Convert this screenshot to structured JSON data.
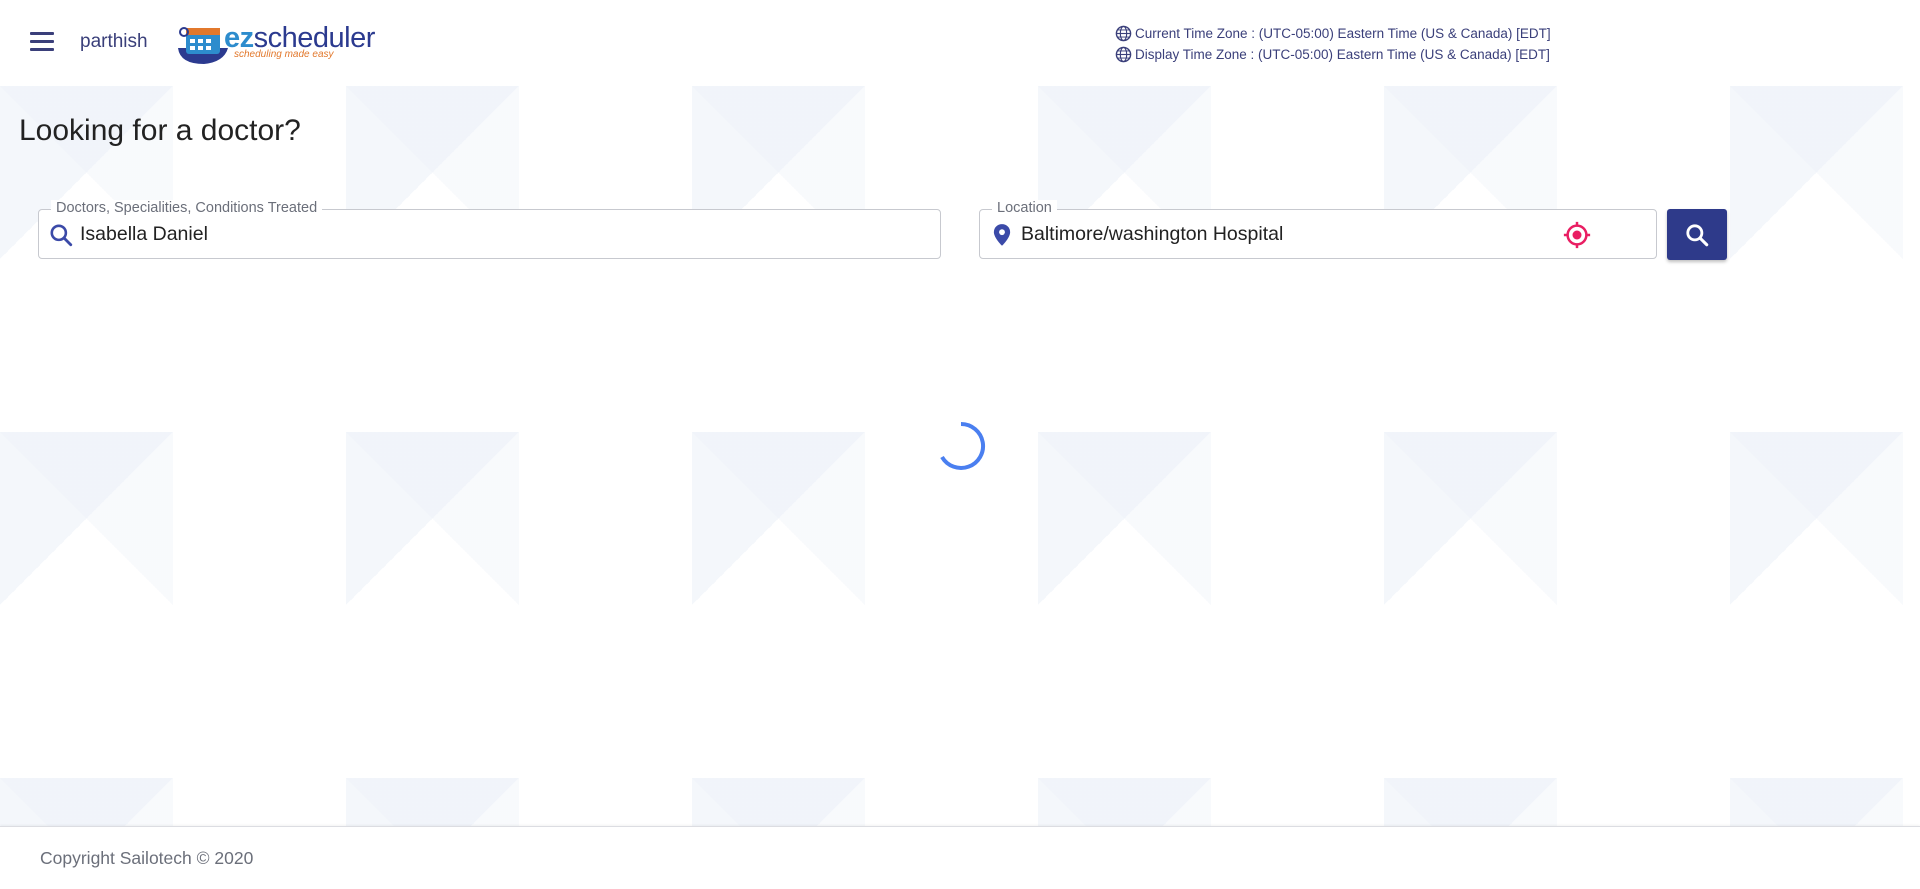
{
  "header": {
    "username": "parthish",
    "logo": {
      "brand_ez": "ez",
      "brand_rest": "scheduler",
      "tagline": "scheduling made easy"
    },
    "timezones": [
      {
        "text": "Current Time Zone : (UTC-05:00) Eastern Time (US & Canada) [EDT]",
        "icon": "globe-icon"
      },
      {
        "text": "Display Time Zone : (UTC-05:00) Eastern Time (US & Canada) [EDT]",
        "icon": "globe-icon"
      }
    ]
  },
  "main": {
    "title": "Looking for a doctor?",
    "doctor_field": {
      "label": "Doctors, Specialities, Conditions Treated",
      "value": "Isabella Daniel",
      "icon": "search-icon"
    },
    "location_field": {
      "label": "Location",
      "value": "Baltimore/washington Hospital",
      "icon": "location-pin-icon",
      "action_icon": "locate-crosshair-icon"
    },
    "search_button_icon": "search-icon",
    "loading": true
  },
  "footer": {
    "copyright": "Copyright Sailotech © 2020"
  },
  "colors": {
    "primary": "#2e3a8a",
    "text_nav": "#3a3f7a",
    "accent_pink": "#e91e63",
    "spinner": "#4a7ff0"
  }
}
